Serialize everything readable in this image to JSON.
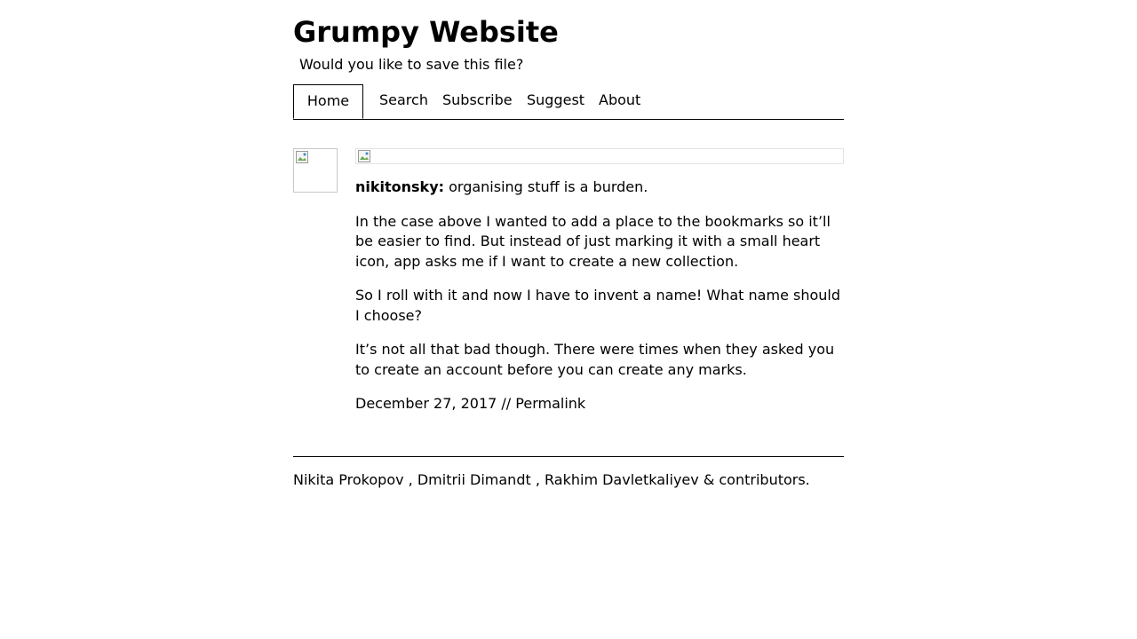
{
  "site": {
    "title": "Grumpy Website",
    "subtitle": "Would you like to save this file?"
  },
  "nav": {
    "items": [
      {
        "label": "Home",
        "active": true
      },
      {
        "label": "Search"
      },
      {
        "label": "Subscribe"
      },
      {
        "label": "Suggest"
      },
      {
        "label": "About"
      }
    ]
  },
  "post": {
    "author": "nikitonsky:",
    "lead": " organising stuff is a burden.",
    "paragraphs": [
      "In the case above I wanted to add a place to the bookmarks so it’ll be easier to find. But instead of just marking it with a small heart icon, app asks me if I want to create a new collection.",
      "So I roll with it and now I have to invent a name! What name should I choose?",
      "It’s not all that bad though. There were times when they asked you to create an account before you can create any marks."
    ],
    "date": "December 27, 2017",
    "separator": " // ",
    "permalink_label": "Permalink"
  },
  "footer": {
    "authors": [
      "Nikita Prokopov",
      "Dmitrii Dimandt",
      "Rakhim Davletkaliyev"
    ],
    "sep": " , ",
    "suffix": " & contributors."
  }
}
